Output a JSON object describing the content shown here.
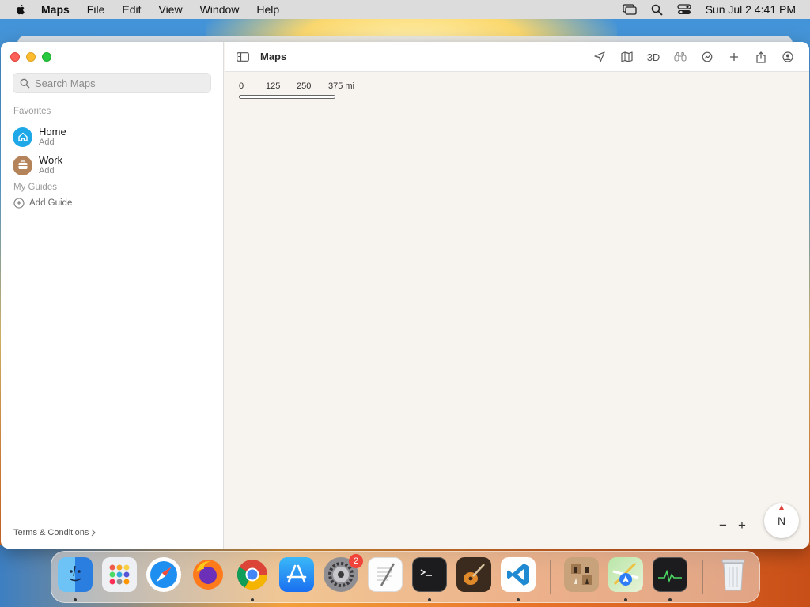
{
  "menubar": {
    "app_name": "Maps",
    "items": [
      "File",
      "Edit",
      "View",
      "Window",
      "Help"
    ],
    "datetime": "Sun Jul 2  4:41 PM"
  },
  "sidebar": {
    "search_placeholder": "Search Maps",
    "favorites_label": "Favorites",
    "favorites": [
      {
        "title": "Home",
        "subtitle": "Add",
        "icon": "house-icon",
        "color": "#1fa8e8"
      },
      {
        "title": "Work",
        "subtitle": "Add",
        "icon": "briefcase-icon",
        "color": "#b5835a"
      }
    ],
    "guides_label": "My Guides",
    "add_guide_label": "Add Guide",
    "terms_label": "Terms & Conditions"
  },
  "main": {
    "title": "Maps",
    "toolbar": {
      "three_d_label": "3D",
      "tools": [
        "location-arrow-icon",
        "map-icon",
        "3d",
        "binoculars-icon",
        "look-around-icon",
        "plus-icon",
        "share-icon",
        "account-icon"
      ]
    },
    "scale": {
      "labels": [
        "0",
        "125",
        "250",
        "375 mi"
      ]
    },
    "zoom": {
      "minus": "−",
      "plus": "+"
    },
    "compass": "N"
  },
  "dock": {
    "apps": [
      "Finder",
      "Launchpad",
      "Safari",
      "Firefox",
      "Chrome",
      "App Store",
      "System Settings",
      "TextEdit",
      "Terminal",
      "GarageBand",
      "VS Code",
      "Chess",
      "Maps",
      "Activity Monitor",
      "Trash"
    ],
    "settings_badge": "2"
  }
}
